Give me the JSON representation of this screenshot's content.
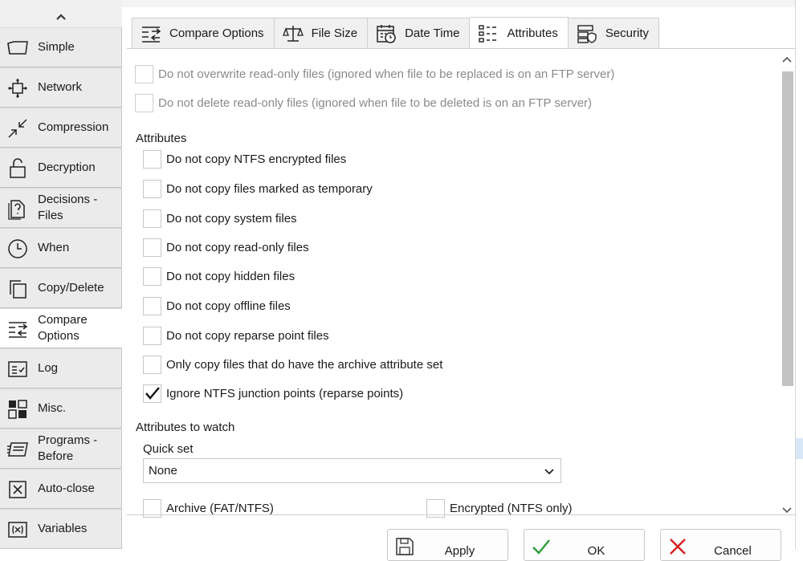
{
  "sidebar": {
    "items": [
      {
        "label": "Simple",
        "icon": "folder-icon"
      },
      {
        "label": "Network",
        "icon": "network-icon"
      },
      {
        "label": "Compression",
        "icon": "compress-icon"
      },
      {
        "label": "Decryption",
        "icon": "unlock-icon"
      },
      {
        "label": "Decisions - Files",
        "icon": "decision-file-icon"
      },
      {
        "label": "When",
        "icon": "clock-icon"
      },
      {
        "label": "Copy/Delete",
        "icon": "copy-icon"
      },
      {
        "label": "Compare Options",
        "icon": "compare-icon",
        "active": true
      },
      {
        "label": "Log",
        "icon": "log-icon"
      },
      {
        "label": "Misc.",
        "icon": "grid-icon"
      },
      {
        "label": "Programs - Before",
        "icon": "programs-icon"
      },
      {
        "label": "Auto-close",
        "icon": "close-box-icon"
      },
      {
        "label": "Variables",
        "icon": "variables-icon"
      }
    ]
  },
  "tabs": [
    {
      "label": "Compare Options",
      "icon": "compare-icon"
    },
    {
      "label": "File Size",
      "icon": "scale-icon"
    },
    {
      "label": "Date Time",
      "icon": "calendar-clock-icon"
    },
    {
      "label": "Attributes",
      "icon": "attributes-list-icon",
      "active": true
    },
    {
      "label": "Security",
      "icon": "shield-stack-icon"
    }
  ],
  "readonly_options": [
    {
      "label": "Do not overwrite read-only files (ignored when file to be replaced is on an FTP server)",
      "checked": false,
      "disabled": true
    },
    {
      "label": "Do not delete read-only files (ignored when file to be deleted is on an FTP server)",
      "checked": false,
      "disabled": true
    }
  ],
  "attributes": {
    "heading": "Attributes",
    "options": [
      {
        "label": "Do not copy NTFS encrypted files",
        "checked": false
      },
      {
        "label": "Do not copy files marked as temporary",
        "checked": false
      },
      {
        "label": "Do not copy system files",
        "checked": false
      },
      {
        "label": "Do not copy read-only files",
        "checked": false
      },
      {
        "label": "Do not copy hidden files",
        "checked": false
      },
      {
        "label": "Do not copy offline files",
        "checked": false
      },
      {
        "label": "Do not copy reparse point files",
        "checked": false
      },
      {
        "label": "Only copy files that do have the archive attribute set",
        "checked": false
      },
      {
        "label": "Ignore NTFS junction points (reparse points)",
        "checked": true
      }
    ]
  },
  "watch": {
    "heading": "Attributes to watch",
    "quickset_label": "Quick set",
    "quickset_value": "None",
    "options": [
      {
        "label": "Archive (FAT/NTFS)",
        "checked": false
      },
      {
        "label": "Encrypted (NTFS only)",
        "checked": false
      }
    ]
  },
  "buttons": {
    "apply": "Apply",
    "ok": "OK",
    "cancel": "Cancel"
  },
  "colors": {
    "ok_check": "#2e9d3a",
    "cancel_x": "#d42020",
    "sidebar_bg": "#ebebeb"
  }
}
